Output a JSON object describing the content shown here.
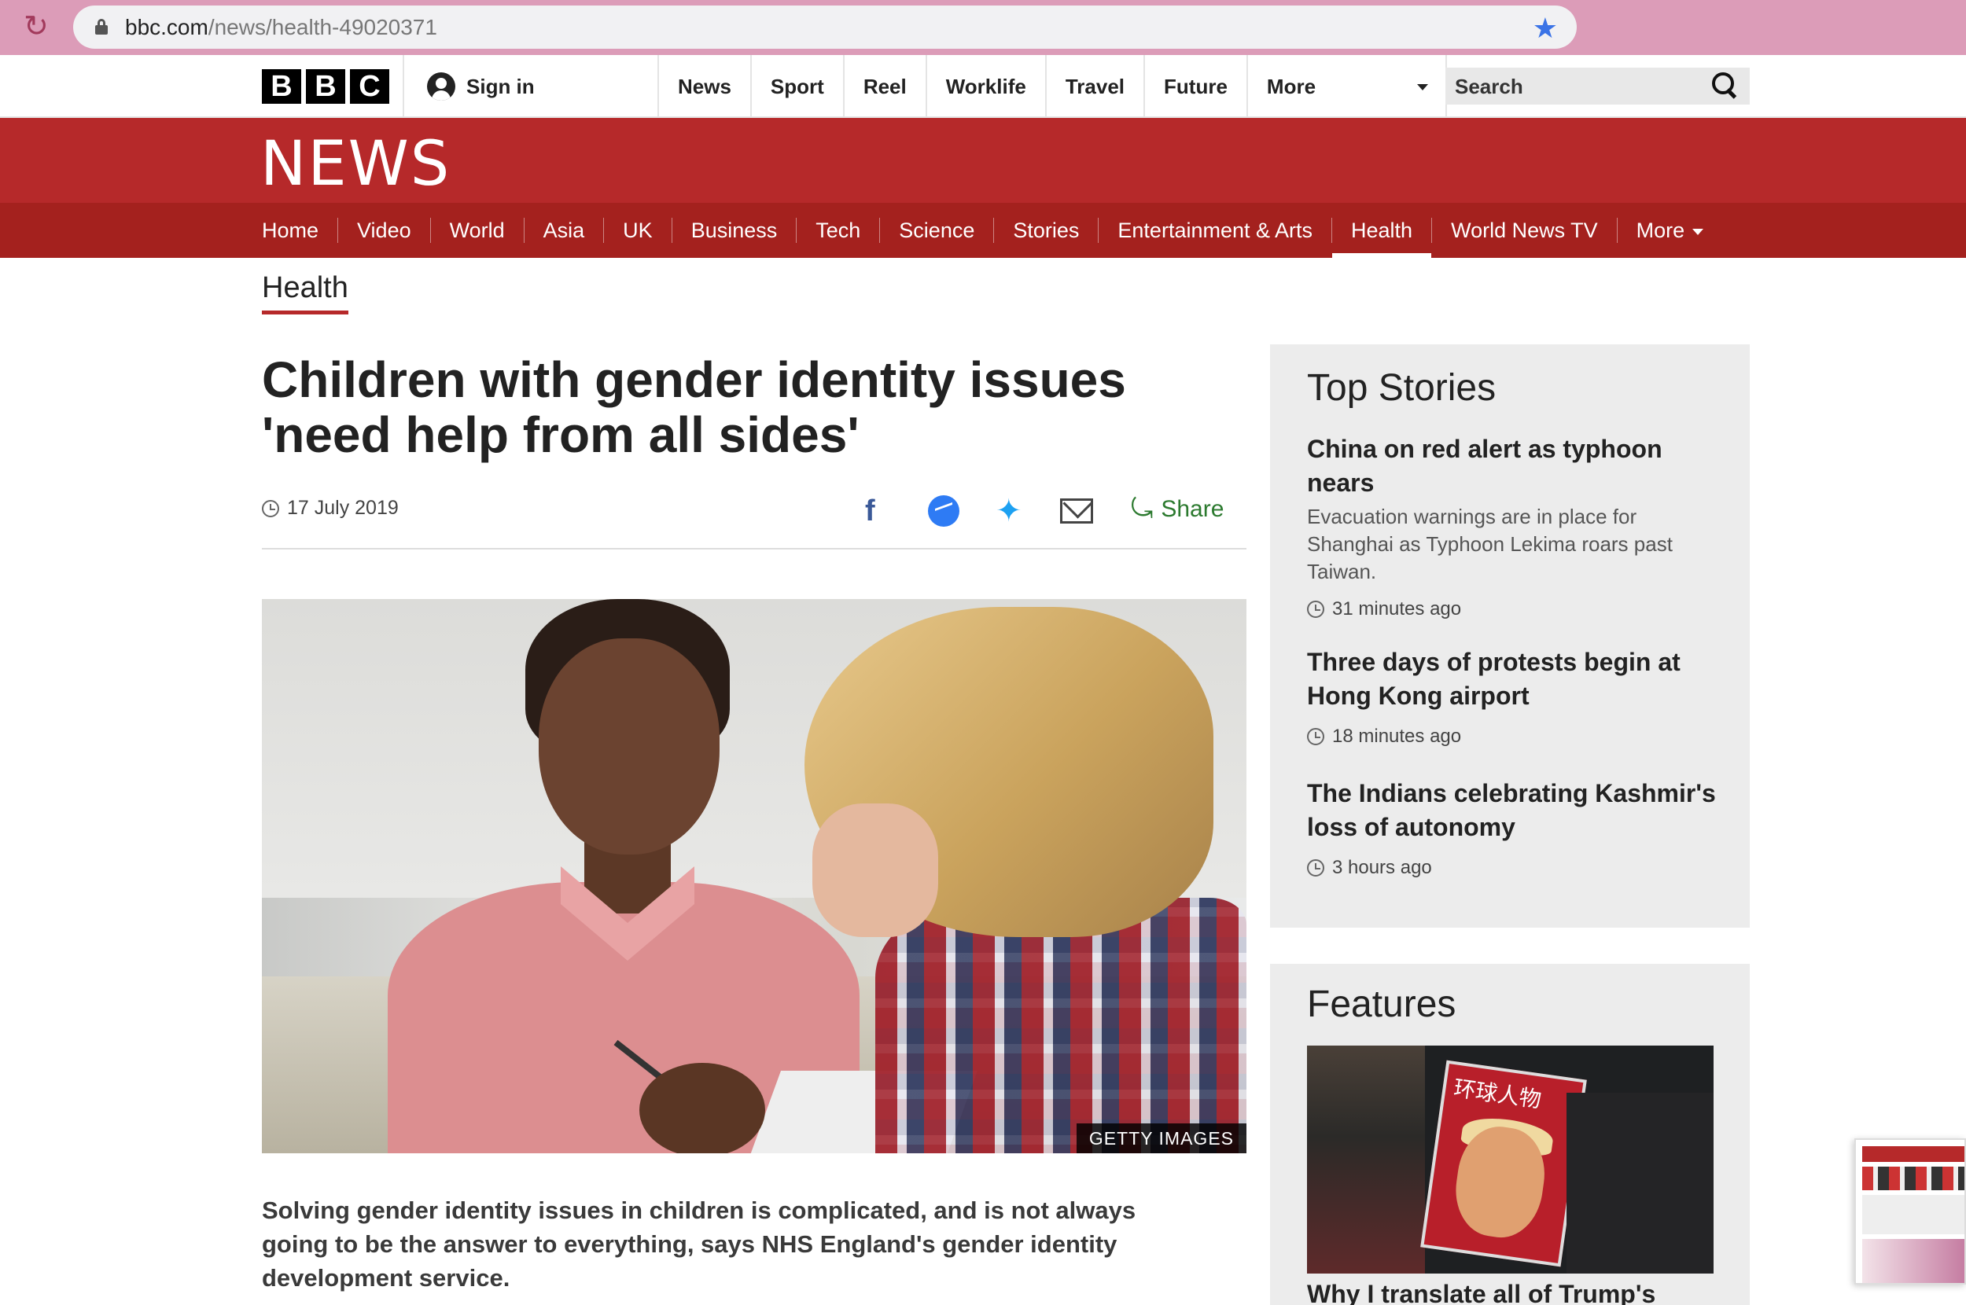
{
  "browser": {
    "url_domain": "bbc.com",
    "url_path": "/news/health-49020371"
  },
  "topbar": {
    "logo_letters": [
      "B",
      "B",
      "C"
    ],
    "sign_in": "Sign in",
    "nav": [
      "News",
      "Sport",
      "Reel",
      "Worklife",
      "Travel",
      "Future",
      "More"
    ],
    "search_placeholder": "Search"
  },
  "masthead": {
    "title": "NEWS",
    "nav": [
      "Home",
      "Video",
      "World",
      "Asia",
      "UK",
      "Business",
      "Tech",
      "Science",
      "Stories",
      "Entertainment & Arts",
      "Health",
      "World News TV",
      "More"
    ],
    "active": "Health"
  },
  "section": {
    "title": "Health"
  },
  "article": {
    "headline": "Children with gender identity issues 'need help from all sides'",
    "date": "17 July 2019",
    "share_label": "Share",
    "image_credit": "GETTY IMAGES",
    "intro": "Solving gender identity issues in children is complicated, and is not always going to be the answer to everything, says NHS England's gender identity development service."
  },
  "sidebar": {
    "top_stories_title": "Top Stories",
    "stories": [
      {
        "headline": "China on red alert as typhoon nears",
        "summary": "Evacuation warnings are in place for Shanghai as Typhoon Lekima roars past Taiwan.",
        "time": "31 minutes ago"
      },
      {
        "headline": "Three days of protests begin at Hong Kong airport",
        "summary": "",
        "time": "18 minutes ago"
      },
      {
        "headline": "The Indians celebrating Kashmir's loss of autonomy",
        "summary": "",
        "time": "3 hours ago"
      }
    ],
    "features_title": "Features",
    "feature_magazine_text": "环球人物",
    "feature_caption": "Why I translate all of Trump's"
  },
  "colors": {
    "bbc_red": "#b6292a",
    "bbc_red_dark": "#a4211e",
    "browser_chrome": "#dc9cb8",
    "share_green": "#2c7a2f"
  }
}
